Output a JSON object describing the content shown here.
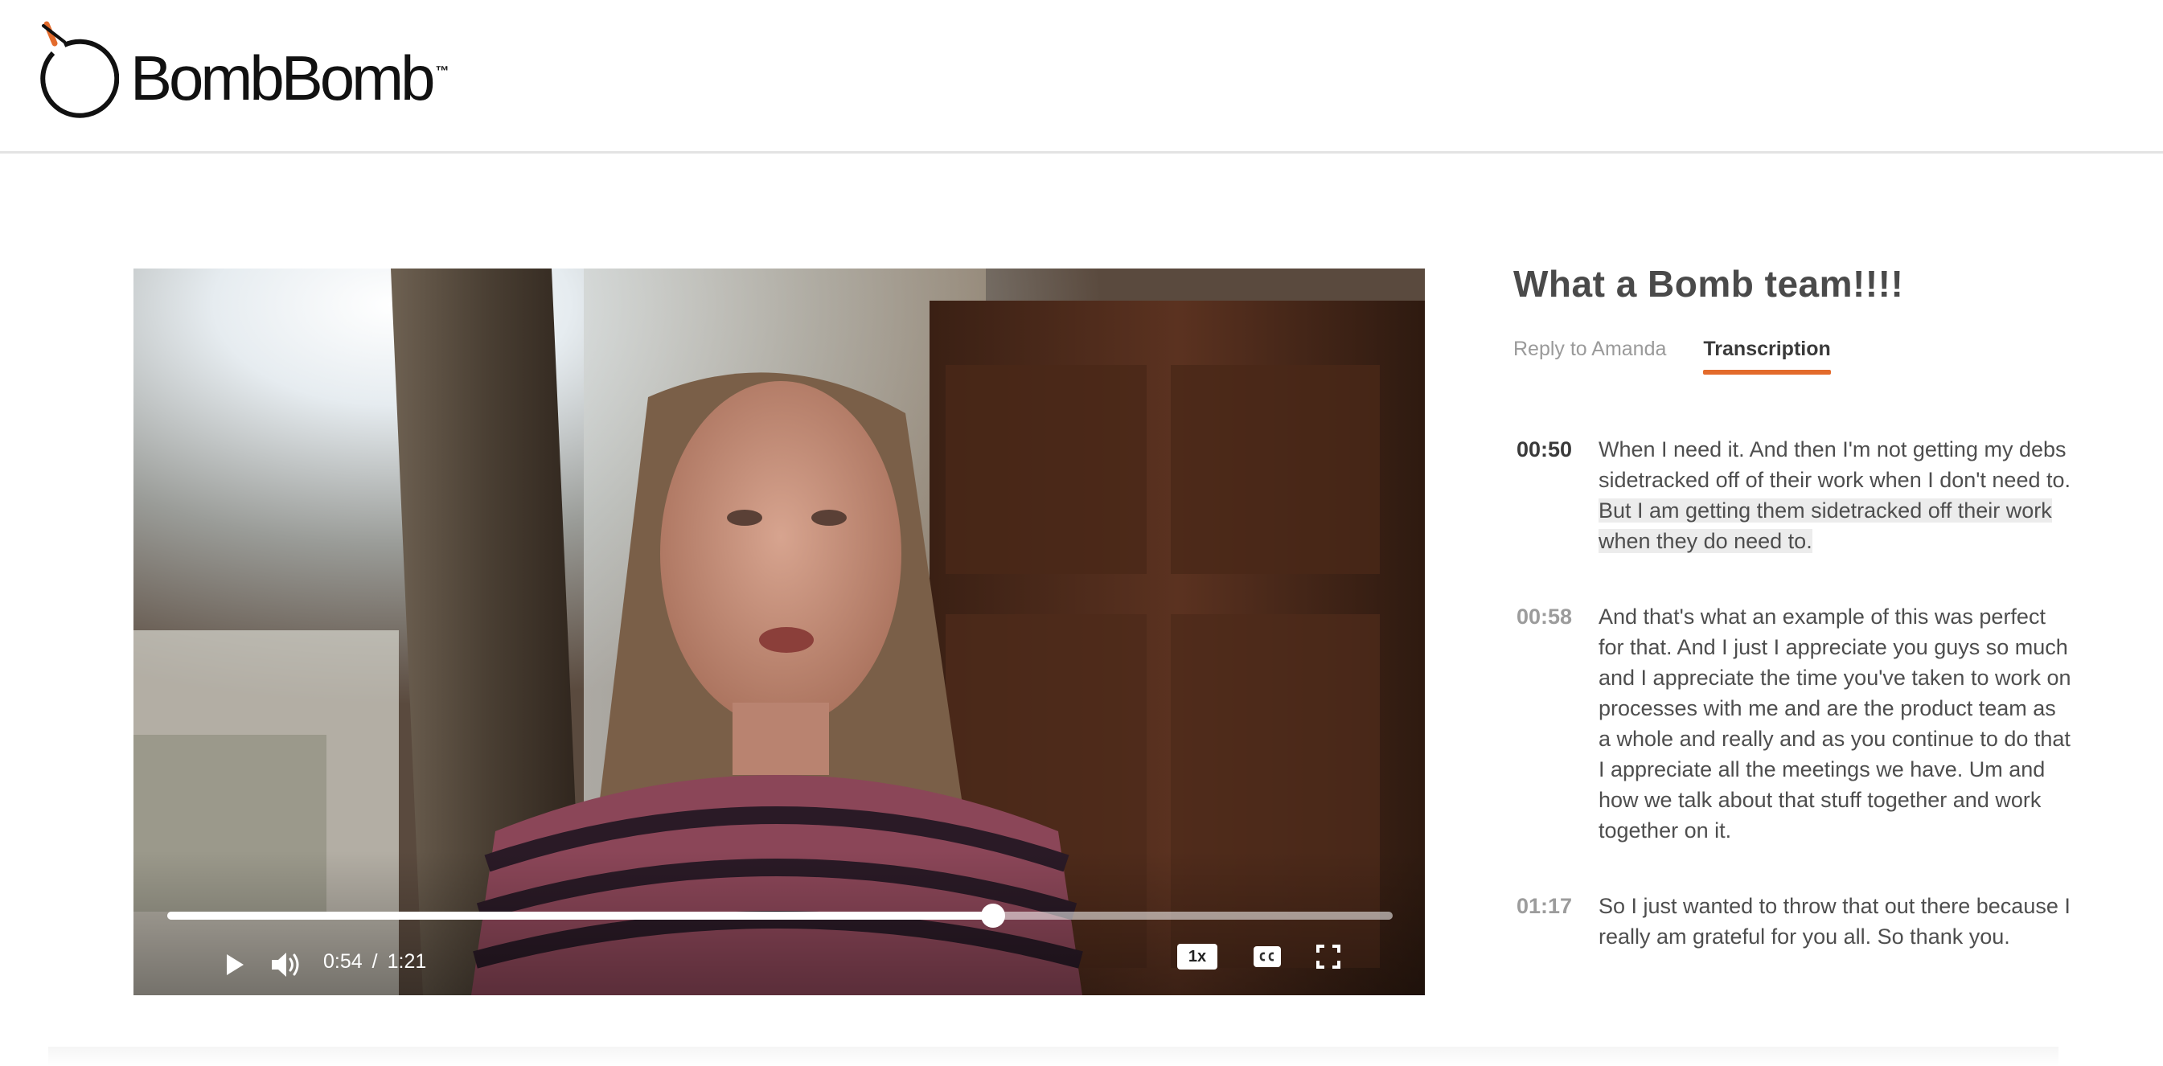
{
  "brand": {
    "name": "BombBomb",
    "trademark": "™",
    "accent_color": "#e36b2c"
  },
  "video": {
    "current_time": "0:54",
    "separator": "/",
    "duration": "1:21",
    "progress_fraction": 0.674,
    "speed_label": "1x",
    "icons": {
      "play": "play-icon",
      "volume": "volume-icon",
      "captions": "closed-captions-icon",
      "fullscreen": "fullscreen-icon"
    }
  },
  "panel": {
    "title": "What a Bomb team!!!!",
    "tabs": [
      {
        "label": "Reply to Amanda",
        "active": false
      },
      {
        "label": "Transcription",
        "active": true
      }
    ]
  },
  "transcript": [
    {
      "time": "00:50",
      "current": true,
      "text": "When I need it. And then I'm not getting my debs sidetracked off of their work when I don't need to. ",
      "highlight": "But I am getting them sidetracked off their work when they do need to."
    },
    {
      "time": "00:58",
      "current": false,
      "text": "And that's what an example of this was perfect for that. And I just I appreciate you guys so much and I appreciate the time you've taken to work on processes with me and are the product team as a whole and really and as you continue to do that I appreciate all the meetings we have. Um and how we talk about that stuff together and work together on it.",
      "highlight": ""
    },
    {
      "time": "01:17",
      "current": false,
      "text": "So I just wanted to throw that out there because I really am grateful for you all. So thank you.",
      "highlight": ""
    }
  ]
}
